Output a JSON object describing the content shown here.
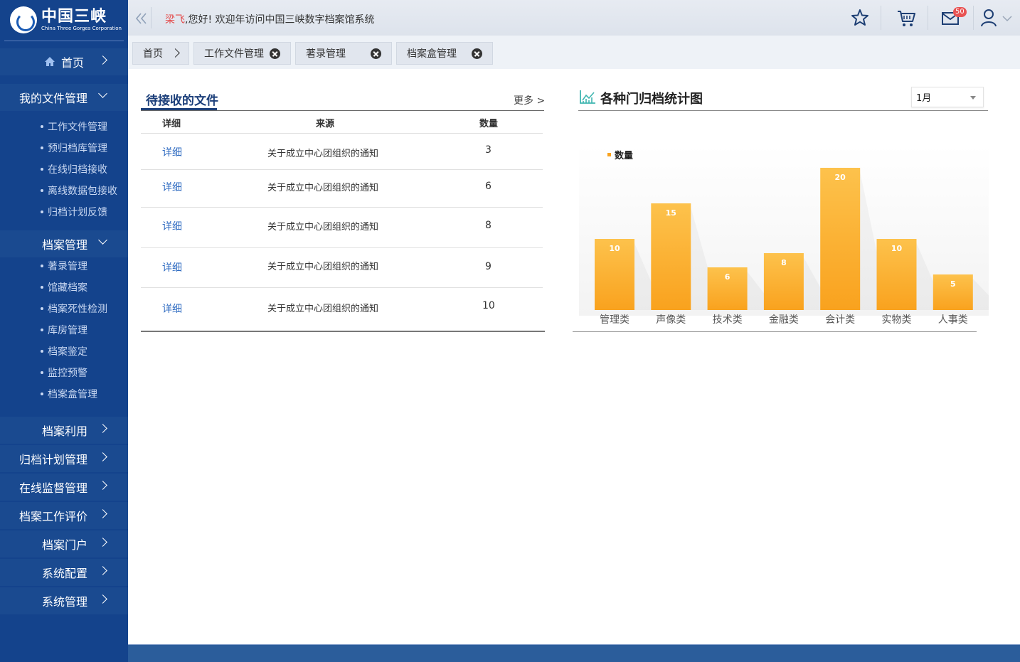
{
  "brand": {
    "name_cn": "中国三峡",
    "name_en": "China Three Gorges Corporation"
  },
  "header": {
    "user_name": "梁飞",
    "welcome_text": ",您好! 欢迎年访问中国三峡数字档案馆系统",
    "mail_badge": "50",
    "icons": [
      "double-chevron-left-icon",
      "star-icon",
      "cart-icon",
      "mail-icon",
      "user-icon",
      "chevron-down-icon"
    ]
  },
  "sidebar": {
    "home": "首页",
    "my_files": {
      "label": "我的文件管理",
      "items": [
        "工作文件管理",
        "预归档库管理",
        "在线归档接收",
        "离线数据包接收",
        "归档计划反馈"
      ]
    },
    "archive_mgmt": {
      "label": "档案管理",
      "items": [
        "著录管理",
        "馆藏档案",
        "档案死性检测",
        "库房管理",
        "档案鉴定",
        "监控预警",
        "档案盒管理"
      ]
    },
    "collapsed": [
      "档案利用",
      "归档计划管理",
      "在线监督管理",
      "档案工作评价",
      "档案门户",
      "系统配置",
      "系统管理"
    ]
  },
  "tabs": [
    "首页",
    "工作文件管理",
    "著录管理",
    "档案盒管理"
  ],
  "pending": {
    "title": "待接收的文件",
    "more": "更多 >",
    "columns": [
      "详细",
      "来源",
      "数量"
    ],
    "rows": [
      {
        "detail": "详细",
        "source": "关于成立中心团组织的通知",
        "qty": "3"
      },
      {
        "detail": "详细",
        "source": "关于成立中心团组织的通知",
        "qty": "6"
      },
      {
        "detail": "详细",
        "source": "关于成立中心团组织的通知",
        "qty": "8"
      },
      {
        "detail": "详细",
        "source": "关于成立中心团组织的通知",
        "qty": "9"
      },
      {
        "detail": "详细",
        "source": "关于成立中心团组织的通知",
        "qty": "10"
      }
    ]
  },
  "chart_panel": {
    "title": "各种门归档统计图",
    "month": "1月"
  },
  "chart_data": {
    "type": "bar",
    "categories": [
      "管理类",
      "声像类",
      "技术类",
      "金融类",
      "会计类",
      "实物类",
      "人事类"
    ],
    "series": [
      {
        "name": "数量",
        "values": [
          10,
          15,
          6,
          8,
          20,
          10,
          5
        ]
      }
    ],
    "ylim": [
      0,
      20
    ],
    "grid": false,
    "legend": "top-left",
    "colors": {
      "bar_top": "#fdc24c",
      "bar_bottom": "#f9a21e"
    }
  },
  "colors": {
    "sidebar_bg": "#14438c",
    "accent": "#1c3f7a",
    "link": "#2f6bc1",
    "user_name": "#e44848"
  }
}
